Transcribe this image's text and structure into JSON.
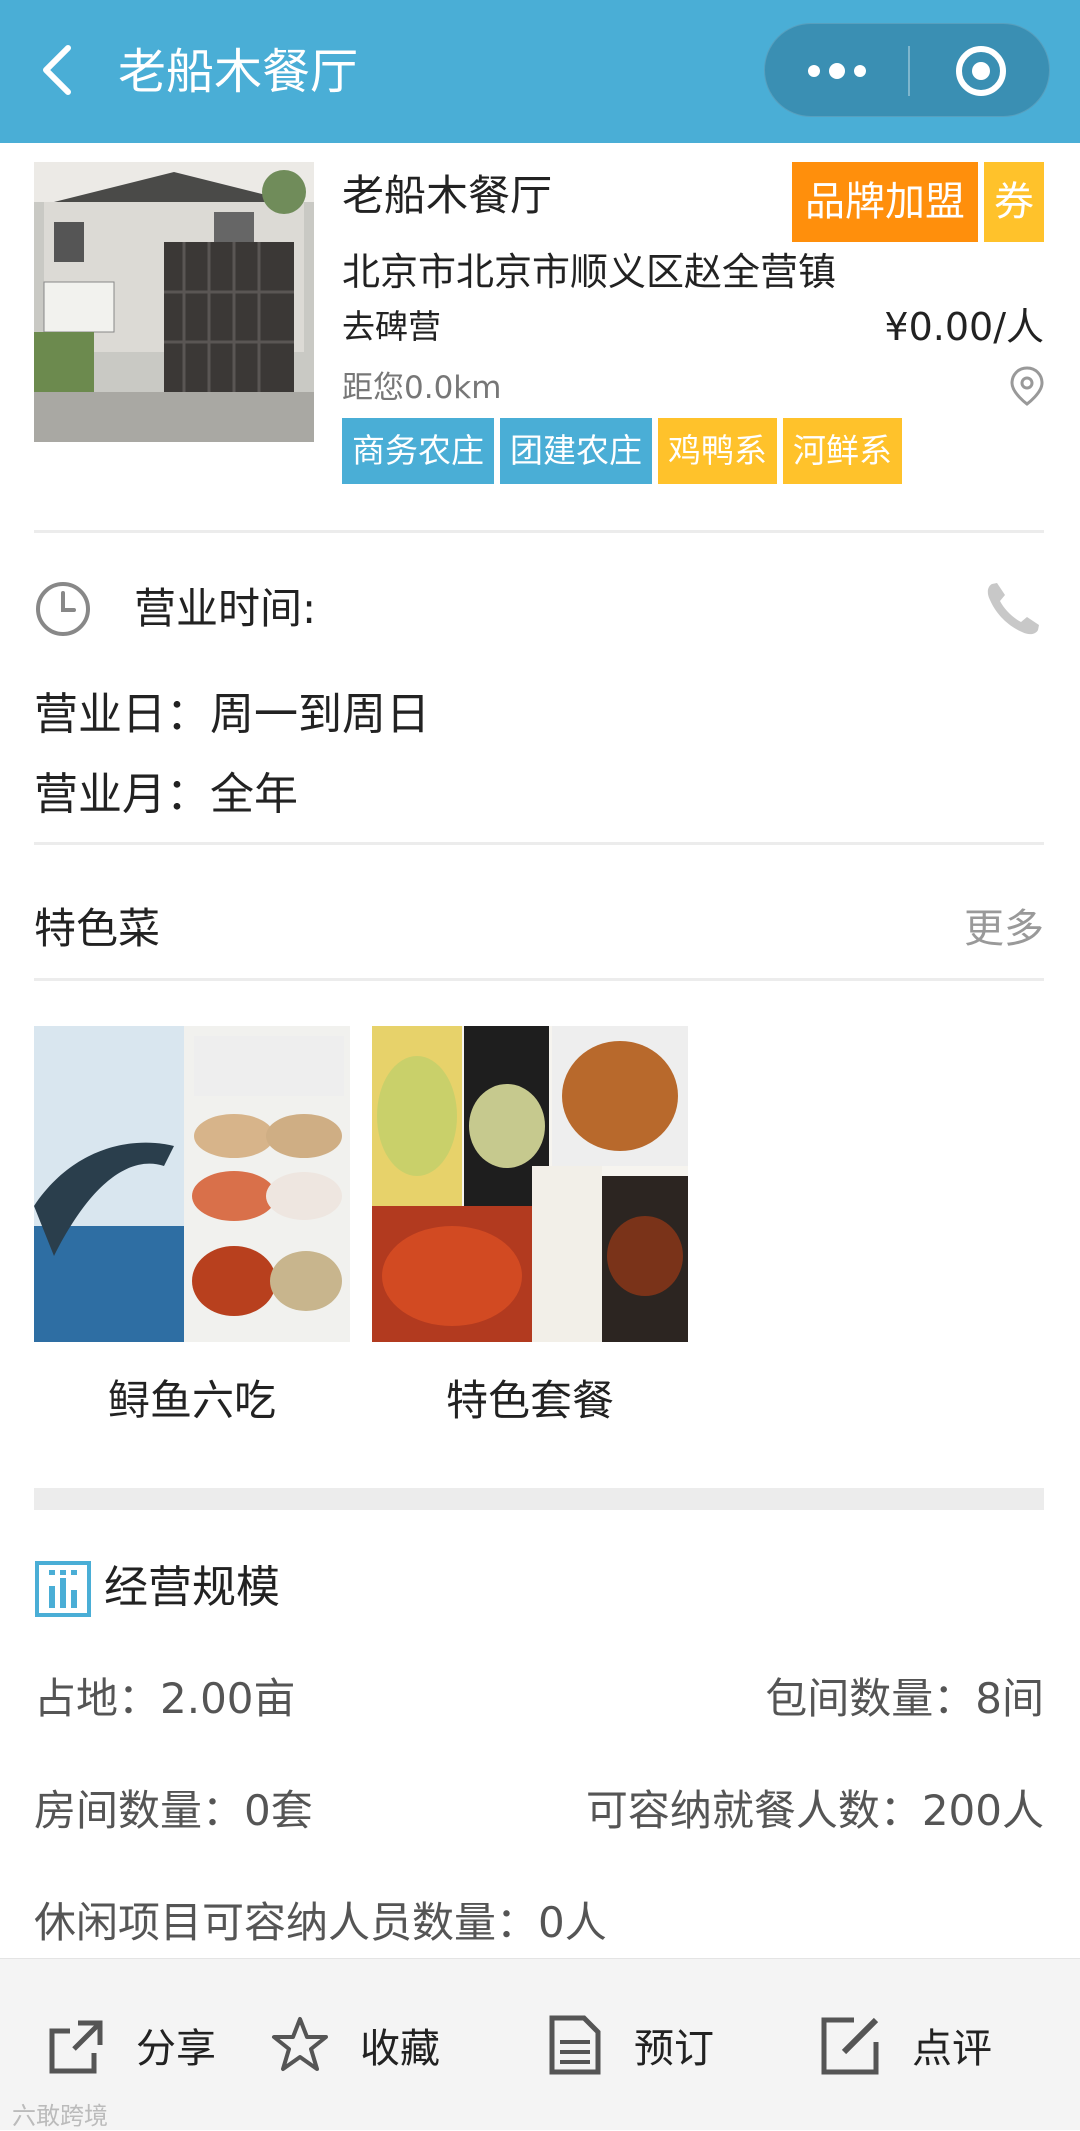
{
  "nav": {
    "title": "老船木餐厅"
  },
  "restaurant": {
    "name": "老船木餐厅",
    "brand_badge": "品牌加盟",
    "coupon_badge": "券",
    "address_line1": "北京市北京市顺义区赵全营镇",
    "address_line2": "去碑营",
    "price": "¥0.00/人",
    "distance": "距您0.0km",
    "tags": [
      {
        "label": "商务农庄",
        "color": "#4aaed6"
      },
      {
        "label": "团建农庄",
        "color": "#4aaed6"
      },
      {
        "label": "鸡鸭系",
        "color": "#ffc22b"
      },
      {
        "label": "河鲜系",
        "color": "#ffc22b"
      }
    ]
  },
  "hours": {
    "label": "营业时间:",
    "days": "营业日：周一到周日",
    "months": "营业月：全年"
  },
  "dishes": {
    "title": "特色菜",
    "more": "更多",
    "items": [
      {
        "name": "鲟鱼六吃"
      },
      {
        "name": "特色套餐"
      }
    ]
  },
  "scale": {
    "title": "经营规模",
    "land": "占地：2.00亩",
    "private_rooms": "包间数量：8间",
    "rooms": "房间数量：0套",
    "diners": "可容纳就餐人数：200人",
    "leisure": "休闲项目可容纳人员数量：0人"
  },
  "bottom_bar": {
    "share": "分享",
    "favorite": "收藏",
    "reserve": "预订",
    "review": "点评"
  },
  "watermark": "六敢跨境",
  "colors": {
    "primary": "#4aaed6",
    "orange": "#ff8f0c",
    "yellow": "#ffc22b"
  }
}
